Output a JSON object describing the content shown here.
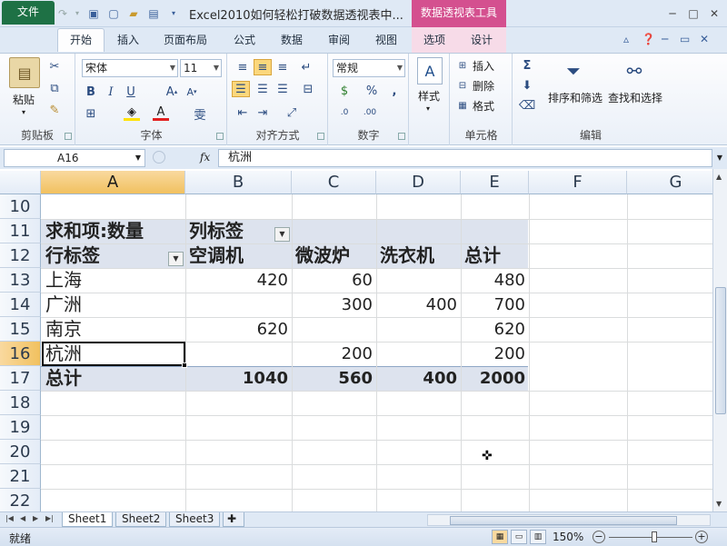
{
  "title_bar": {
    "doc_title": "Excel2010如何轻松打破数据透视表中...",
    "context_tab": "数据透视表工具",
    "logo_icon": "excel-logo-icon",
    "logo_text": "X",
    "undo_glyph": "↶",
    "redo_glyph": "↷",
    "save_glyph": "▣",
    "window_min": "─",
    "window_max": "□",
    "window_close": "✕"
  },
  "ribbon_tabs": {
    "file": "文件",
    "home": "开始",
    "insert": "插入",
    "page_layout": "页面布局",
    "formulas": "公式",
    "data": "数据",
    "review": "审阅",
    "view": "视图",
    "options": "选项",
    "design": "设计"
  },
  "ribbon": {
    "clipboard": {
      "label": "剪贴板",
      "paste": "粘贴"
    },
    "font": {
      "label": "字体",
      "name": "宋体",
      "size": "11"
    },
    "alignment": {
      "label": "对齐方式"
    },
    "number": {
      "label": "数字",
      "format": "常规"
    },
    "styles": {
      "button": "样式"
    },
    "cells": {
      "label": "单元格",
      "insert": "插入",
      "delete": "删除",
      "format": "格式"
    },
    "editing": {
      "label": "编辑",
      "sort_filter": "排序和筛选",
      "find_select": "查找和选择",
      "sum": "Σ"
    }
  },
  "formula_bar": {
    "name_box": "A16",
    "fx": "fx",
    "value": "杭洲"
  },
  "columns": [
    "A",
    "B",
    "C",
    "D",
    "E",
    "F",
    "G"
  ],
  "rows": [
    "10",
    "11",
    "12",
    "13",
    "14",
    "15",
    "16",
    "17",
    "18",
    "19",
    "20",
    "21",
    "22"
  ],
  "pivot": {
    "header_left": "求和项:数量",
    "header_right": "列标签",
    "row_label": "行标签",
    "col_headers": [
      "空调机",
      "微波炉",
      "洗衣机",
      "总计"
    ],
    "data_rows": [
      {
        "label": "上海",
        "values": [
          "420",
          "60",
          "",
          "480"
        ]
      },
      {
        "label": "广洲",
        "values": [
          "",
          "300",
          "400",
          "700"
        ]
      },
      {
        "label": "南京",
        "values": [
          "620",
          "",
          "",
          "620"
        ]
      },
      {
        "label": "杭洲",
        "values": [
          "",
          "200",
          "",
          "200"
        ]
      }
    ],
    "total_row": {
      "label": "总计",
      "values": [
        "1040",
        "560",
        "400",
        "2000"
      ]
    }
  },
  "sheets": [
    "Sheet1",
    "Sheet2",
    "Sheet3"
  ],
  "status": {
    "text": "就绪",
    "zoom": "150%"
  }
}
